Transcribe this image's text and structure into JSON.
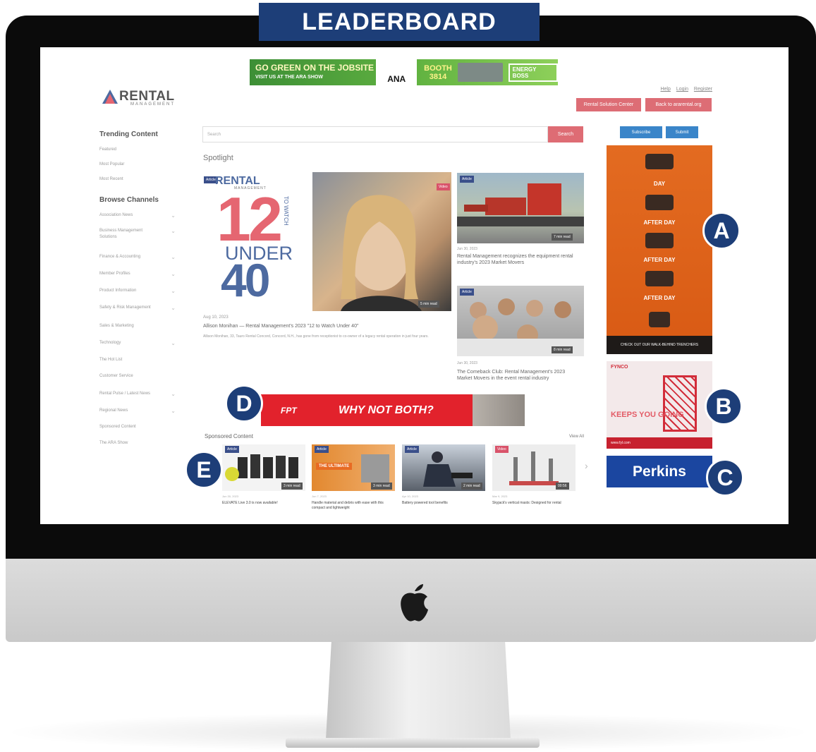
{
  "callouts": {
    "title": "LEADERBOARD",
    "badges": [
      "A",
      "B",
      "C",
      "D",
      "E"
    ]
  },
  "leaderboard_ad": {
    "line1": "GO GREEN ON THE JOBSITE",
    "line2": "VISIT US AT THE ARA SHOW",
    "brand": "ANA",
    "booth": "BOOTH 3814",
    "partner": "ENERGY BOSS"
  },
  "header": {
    "logo": "RENTAL",
    "logo_sub": "MANAGEMENT",
    "links": [
      "Help",
      "Login",
      "Register"
    ],
    "btn_solutions": "Rental Solution Center",
    "btn_back": "Back to ararental.org"
  },
  "sidebar": {
    "trending_heading": "Trending Content",
    "trending": [
      "Featured",
      "Most Popular",
      "Most Recent"
    ],
    "browse_heading": "Browse Channels",
    "channels": [
      {
        "label": "Association News",
        "chevron": true
      },
      {
        "label": "Business Management Solutions",
        "chevron": true
      },
      {
        "label": "Finance & Accounting",
        "chevron": true
      },
      {
        "label": "Member Profiles",
        "chevron": true
      },
      {
        "label": "Product Information",
        "chevron": true
      },
      {
        "label": "Safety & Risk Management",
        "chevron": true
      },
      {
        "label": "Sales & Marketing",
        "chevron": false
      },
      {
        "label": "Technology",
        "chevron": true
      },
      {
        "label": "The Hot List",
        "chevron": false
      },
      {
        "label": "Customer Service",
        "chevron": false
      },
      {
        "label": "Rental Pulse / Latest News",
        "chevron": true
      },
      {
        "label": "Regional News",
        "chevron": true
      },
      {
        "label": "Sponsored Content",
        "chevron": false
      },
      {
        "label": "The ARA Show",
        "chevron": false
      }
    ]
  },
  "search": {
    "placeholder": "Search",
    "button": "Search",
    "subscribe": "Subscribe",
    "submit": "Submit"
  },
  "spotlight": {
    "heading": "Spotlight",
    "feature": {
      "tag": "Article",
      "logo": "RENTAL",
      "logo_sub": "MANAGEMENT",
      "big_12": "12",
      "to_watch": "TO WATCH",
      "under": "UNDER",
      "big_40": "40",
      "date": "Aug 10, 2023",
      "title": "Allison Monihan — Rental Management's 2023 \"12 to Watch Under 40\"",
      "excerpt": "Allison Monihan, 33, Tauro Rental Concord, Concord, N.H., has gone from receptionist to co-owner of a legacy rental operation in just four years."
    },
    "photo_card": {
      "tag": "Video",
      "read": "5 min read"
    },
    "side_cards": [
      {
        "tag": "Article",
        "read": "7 min read",
        "date": "Jun 30, 2023",
        "title": "Rental Management recognizes the equipment rental industry's 2023 Market Movers"
      },
      {
        "tag": "Article",
        "read": "8 min read",
        "date": "Jun 30, 2023",
        "title": "The Comeback Club: Rental Management's 2023 Market Movers in the event rental industry"
      }
    ]
  },
  "ads": {
    "a": {
      "labels": [
        "DAY",
        "AFTER DAY",
        "AFTER DAY",
        "AFTER DAY"
      ],
      "footer": "CHECK OUT OUR WALK-BEHIND TRENCHERS"
    },
    "b": {
      "brand": "FYNCO",
      "headline": "KEEPS YOU GOING",
      "url": "www.fyl.com"
    },
    "c": {
      "brand": "Perkins"
    },
    "d": {
      "brand": "FPT",
      "headline": "WHY NOT BOTH?"
    }
  },
  "sponsored": {
    "heading": "Sponsored Content",
    "view_all": "View All",
    "items": [
      {
        "tag": "Article",
        "read": "3 min read",
        "date": "Jun 30, 2023",
        "title": "ELEVATE Live 3.0 is now available!"
      },
      {
        "tag": "Article",
        "banner": "THE ULTIMATE",
        "read": "3 min read",
        "date": "Jun 7, 2023",
        "title": "Handle material and debris with ease with this compact and lightweight"
      },
      {
        "tag": "Article",
        "read": "2 min read",
        "date": "Apr 10, 2023",
        "title": "Battery powered tool benefits"
      },
      {
        "tag": "Video",
        "read": "00:56",
        "date": "Mar 9, 2023",
        "title": "Skyjack's vertical masts: Designed for rental"
      }
    ]
  }
}
